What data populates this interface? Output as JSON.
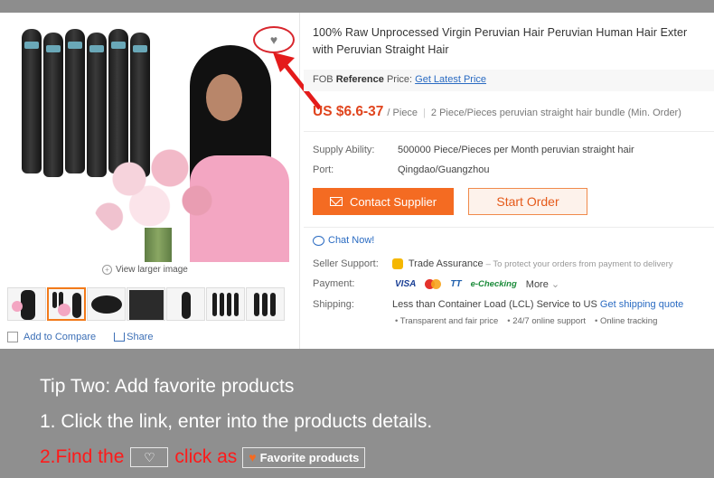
{
  "product": {
    "title_line1": "100% Raw Unprocessed Virgin Peruvian Hair Peruvian Human Hair Exter",
    "title_line2": "with Peruvian Straight Hair",
    "fob_prefix": "FOB",
    "fob_bold": "Reference",
    "fob_suffix": "Price:",
    "fob_link": "Get Latest Price",
    "price": "US $6.6-37",
    "price_unit": "/ Piece",
    "min_order": "2 Piece/Pieces peruvian straight hair bundle (Min. Order)"
  },
  "specs": {
    "supply_label": "Supply Ability:",
    "supply_value": "500000 Piece/Pieces per Month peruvian straight hair",
    "port_label": "Port:",
    "port_value": "Qingdao/Guangzhou"
  },
  "actions": {
    "contact": "Contact Supplier",
    "order": "Start Order",
    "chat": "Chat Now!"
  },
  "seller": {
    "support_label": "Seller Support:",
    "trade": "Trade Assurance",
    "trade_note": "– To protect your orders from payment to delivery",
    "payment_label": "Payment:",
    "pay_visa": "VISA",
    "pay_tt": "TT",
    "pay_echeck": "e-Checking",
    "pay_more": "More",
    "shipping_label": "Shipping:",
    "shipping_value": "Less than Container Load (LCL) Service to US",
    "shipping_link": "Get shipping quote",
    "bullets": [
      "Transparent and fair price",
      "24/7 online support",
      "Online tracking"
    ]
  },
  "gallery": {
    "view_larger": "View larger image",
    "compare": "Add to Compare",
    "share": "Share"
  },
  "tips": {
    "title": "Tip Two: Add favorite products",
    "step1": "1. Click the link, enter into the products details.",
    "step2_prefix": "2.Find the",
    "step2_mid": "click as",
    "favorite_chip": "Favorite products"
  }
}
